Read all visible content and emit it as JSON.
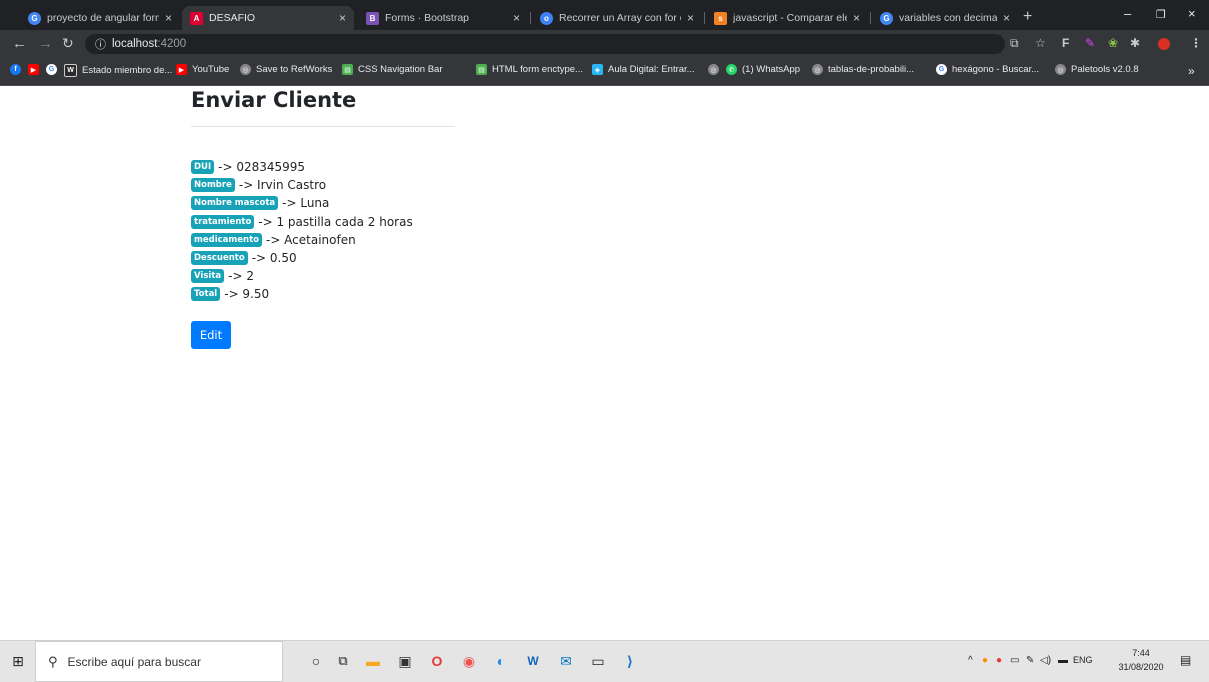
{
  "tabs": [
    {
      "title": "proyecto de angular formulario",
      "fav": "G",
      "color": "#4285f4"
    },
    {
      "title": "DESAFIO",
      "fav": "A",
      "color": "#dd0031"
    },
    {
      "title": "Forms · Bootstrap",
      "fav": "B",
      "color": "#7952b3"
    },
    {
      "title": "Recorrer un Array con for of en",
      "fav": "o",
      "color": "#3b82f6"
    },
    {
      "title": "javascript - Comparar elemento",
      "fav": "s",
      "color": "#f48024"
    },
    {
      "title": "variables con decimales en c++",
      "fav": "G",
      "color": "#4285f4"
    }
  ],
  "address": {
    "host": "localhost",
    "port": ":4200"
  },
  "bookmarks": [
    "Estado miembro de...",
    "YouTube",
    "Save to RefWorks",
    "CSS Navigation Bar",
    "HTML form enctype...",
    "Aula Digital: Entrar...",
    "(1) WhatsApp",
    "tablas-de-probabili...",
    "hexágono - Buscar...",
    "Paletools v2.0.8"
  ],
  "page": {
    "title": "Enviar Cliente",
    "fields": [
      {
        "label": "DUI",
        "value": "-> 028345995"
      },
      {
        "label": "Nombre",
        "value": "-> Irvin Castro"
      },
      {
        "label": "Nombre mascota",
        "value": "-> Luna"
      },
      {
        "label": "tratamiento",
        "value": "-> 1 pastilla cada 2 horas"
      },
      {
        "label": "medicamento",
        "value": "-> Acetainofen"
      },
      {
        "label": "Descuento",
        "value": "-> 0.50"
      },
      {
        "label": "Visita",
        "value": "-> 2"
      },
      {
        "label": "Total",
        "value": "-> 9.50"
      }
    ],
    "edit_label": "Edit"
  },
  "taskbar": {
    "search_placeholder": "Escribe aquí para buscar",
    "lang": "ENG",
    "time": "7:44",
    "date": "31/08/2020"
  }
}
